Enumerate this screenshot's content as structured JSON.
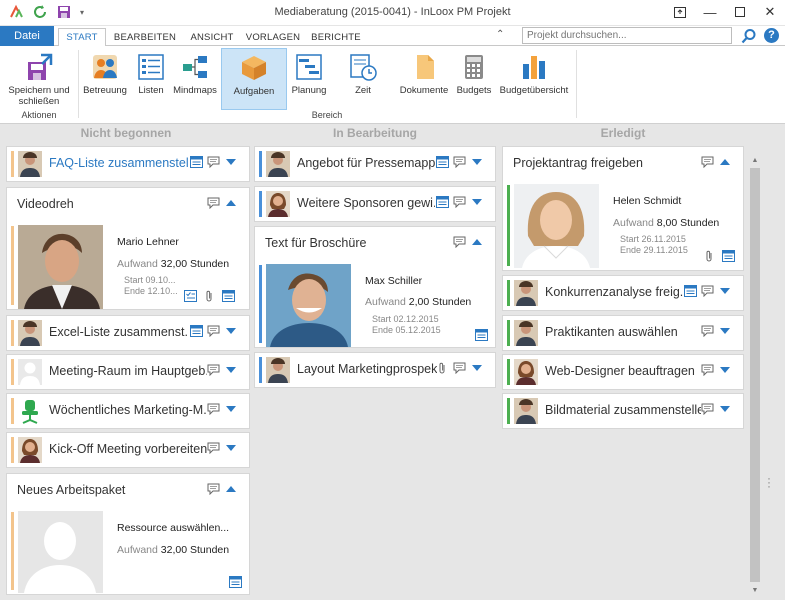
{
  "window": {
    "title": "Mediaberatung (2015-0041) - InLoox PM Projekt"
  },
  "ribbon_tabs": {
    "file": "Datei",
    "tabs": [
      "START",
      "BEARBEITEN",
      "ANSICHT",
      "VORLAGEN",
      "BERICHTE"
    ],
    "active": "START"
  },
  "search": {
    "placeholder": "Projekt durchsuchen..."
  },
  "help": "?",
  "ribbon": {
    "save_close": "Speichern und schließen",
    "group_actions": "Aktionen",
    "buttons": [
      "Betreuung",
      "Listen",
      "Mindmaps",
      "Aufgaben",
      "Planung",
      "Zeit",
      "Dokumente",
      "Budgets",
      "Budgetübersicht"
    ],
    "group_area": "Bereich"
  },
  "colors": {
    "accent": "#2b79c2",
    "bar_orange": "#f3c48c",
    "bar_blue": "#4a90d9",
    "bar_green": "#4caf50"
  },
  "columns": {
    "not_started": "Nicht begonnen",
    "in_progress": "In Bearbeitung",
    "done": "Erledigt"
  },
  "cards": {
    "faq": {
      "title": "FAQ-Liste zusammenstell..."
    },
    "videodreh": {
      "title": "Videodreh",
      "person": "Mario Lehner",
      "effort_label": "Aufwand",
      "effort": "32,00 Stunden",
      "start_label": "Start",
      "start": "09.10...",
      "end_label": "Ende",
      "end": "12.10..."
    },
    "excel": {
      "title": "Excel-Liste zusammenst..."
    },
    "meeting": {
      "title": "Meeting-Raum im Hauptgeb..."
    },
    "weekly": {
      "title": "Wöchentliches Marketing-M..."
    },
    "kickoff": {
      "title": "Kick-Off Meeting vorbereiten"
    },
    "neues": {
      "title": "Neues Arbeitspaket",
      "person": "Ressource auswählen...",
      "effort_label": "Aufwand",
      "effort": "32,00 Stunden"
    },
    "angebot": {
      "title": "Angebot für Pressemapp..."
    },
    "sponsoren": {
      "title": "Weitere Sponsoren gewi..."
    },
    "broschuere": {
      "title": "Text für Broschüre",
      "person": "Max Schiller",
      "effort_label": "Aufwand",
      "effort": "2,00 Stunden",
      "start_label": "Start",
      "start": "02.12.2015",
      "end_label": "Ende",
      "end": "05.12.2015"
    },
    "layout": {
      "title": "Layout Marketingprospekt"
    },
    "antrag": {
      "title": "Projektantrag freigeben",
      "person": "Helen Schmidt",
      "effort_label": "Aufwand",
      "effort": "8,00 Stunden",
      "start_label": "Start",
      "start": "26.11.2015",
      "end_label": "Ende",
      "end": "29.11.2015"
    },
    "konkurrenz": {
      "title": "Konkurrenzanalyse freig..."
    },
    "praktikanten": {
      "title": "Praktikanten auswählen"
    },
    "webdesigner": {
      "title": "Web-Designer beauftragen"
    },
    "bildmaterial": {
      "title": "Bildmaterial zusammenstellen"
    }
  }
}
